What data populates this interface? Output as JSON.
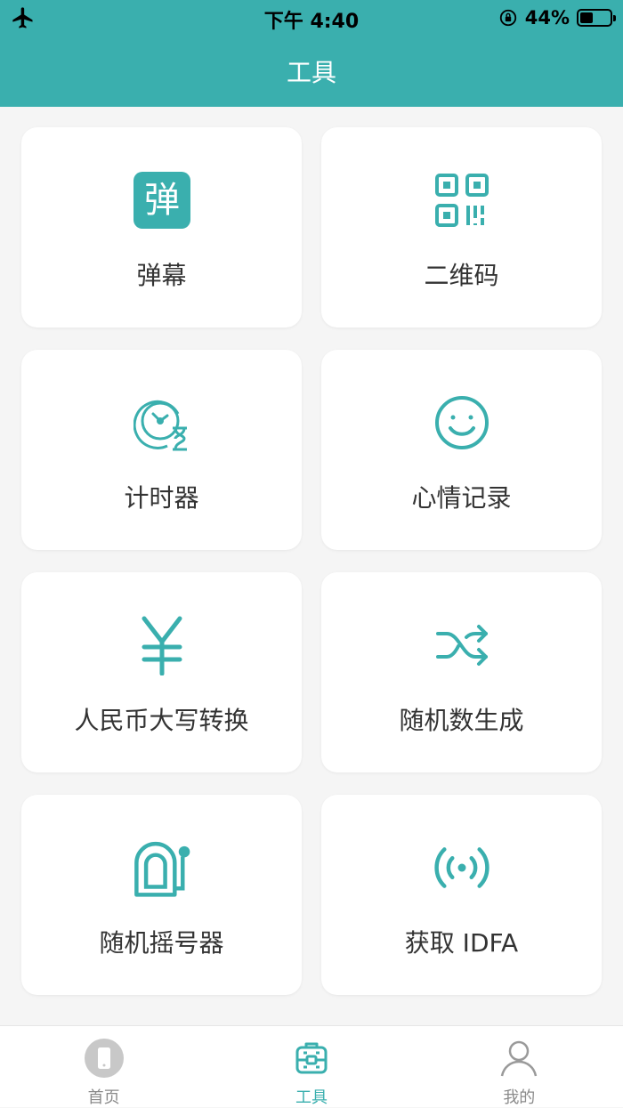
{
  "status": {
    "time": "下午 4:40",
    "battery": "44%",
    "battery_level": 0.44
  },
  "header": {
    "title": "工具"
  },
  "tools": [
    {
      "label": "弹幕",
      "icon": "danmu-icon",
      "icon_text": "弹"
    },
    {
      "label": "二维码",
      "icon": "qrcode-icon"
    },
    {
      "label": "计时器",
      "icon": "timer-icon"
    },
    {
      "label": "心情记录",
      "icon": "smiley-icon"
    },
    {
      "label": "人民币大写转换",
      "icon": "yuan-icon"
    },
    {
      "label": "随机数生成",
      "icon": "shuffle-icon"
    },
    {
      "label": "随机摇号器",
      "icon": "lottery-machine-icon"
    },
    {
      "label": "获取 IDFA",
      "icon": "signal-icon"
    }
  ],
  "tabbar": {
    "items": [
      {
        "label": "首页",
        "icon": "phone-icon",
        "active": false
      },
      {
        "label": "工具",
        "icon": "toolbox-icon",
        "active": true
      },
      {
        "label": "我的",
        "icon": "user-icon",
        "active": false
      }
    ]
  },
  "colors": {
    "accent": "#3aafae",
    "background": "#f5f5f5",
    "card": "#ffffff",
    "text": "#333333",
    "tab_inactive": "#8a8a8a"
  }
}
